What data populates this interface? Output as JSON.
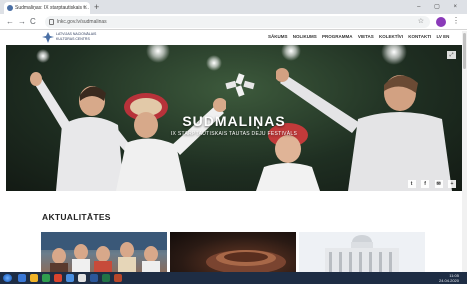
{
  "browser": {
    "tab_title": "Sudmaliņas: IX starptautiskais t...",
    "tab_close": "×",
    "new_tab": "+",
    "window_controls": "– ▢ ×",
    "back": "←",
    "forward": "→",
    "reload": "C",
    "address": "lnkc.gov.lv/sudmalinas",
    "bookmark_star": "☆",
    "menu_dots": "⋮"
  },
  "site": {
    "logo_text_line1": "LATVIJAS NACIONĀLAIS",
    "logo_text_line2": "KULTŪRAS CENTRS",
    "nav_items": [
      "SĀKUMS",
      "NOLIKUMS",
      "PROGRAMMA",
      "VIETAS",
      "KOLEKTĪVI",
      "KONTAKTI"
    ],
    "lang": "LV  EN"
  },
  "hero": {
    "title": "SUDMALIŅAS",
    "subtitle": "IX STARPTAUTISKAIS TAUTAS DEJU FESTIVĀLS",
    "expand_icon": "⤢",
    "share": [
      "t",
      "f",
      "✉",
      "+"
    ]
  },
  "news": {
    "section_title": "AKTUALITĀTES"
  },
  "taskbar": {
    "tray_time": "11:05",
    "tray_date": "24.04.2020"
  },
  "colors": {
    "hero_bg": "#1f2f22",
    "taskbar_bg": "#1e2d44",
    "accent": "#2b3a5c"
  }
}
